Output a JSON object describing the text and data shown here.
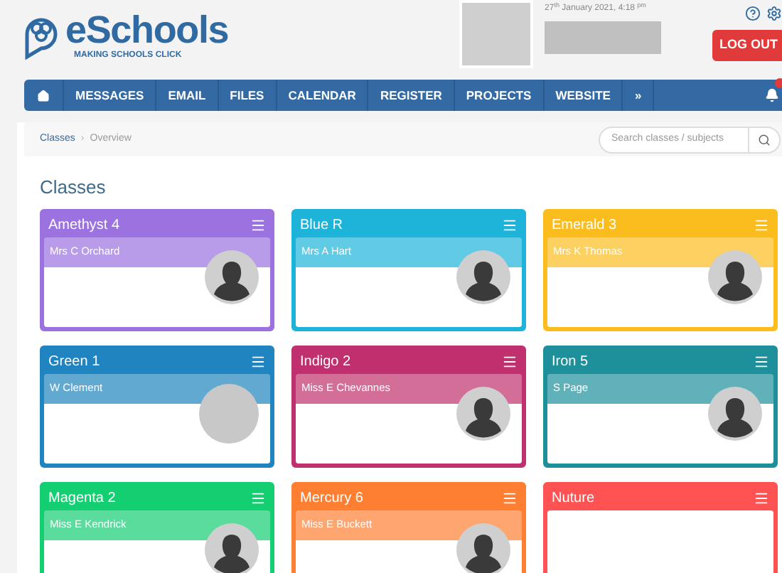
{
  "header": {
    "logo": {
      "name": "eSchools",
      "tagline": "MAKING SCHOOLS CLICK"
    },
    "date": "27$^{th}$ January 2021, 4:18 $^{pm}$",
    "logout": "LOG OUT"
  },
  "nav": {
    "items": [
      {
        "kind": "icon"
      },
      {
        "kind": "text",
        "label": "MESSAGES"
      },
      {
        "kind": "text",
        "label": "EMAIL"
      },
      {
        "kind": "text",
        "label": "FILES"
      },
      {
        "kind": "text",
        "label": "CALENDAR"
      },
      {
        "kind": "text",
        "label": "REGISTER"
      },
      {
        "kind": "text",
        "label": "PROJECTS"
      },
      {
        "kind": "text",
        "label": "WEBSITE"
      },
      {
        "kind": "text",
        "label": "»"
      }
    ]
  },
  "breadcrumb": [
    "Classes",
    "Overview"
  ],
  "breadcrumb_separator": "›",
  "search": {
    "placeholder": "Search classes / subjects"
  },
  "heading": "Classes",
  "classes": [
    {
      "name": "Amethyst 4",
      "teacher": "Mrs C Orchard",
      "color": "#9b72e0",
      "kind": "silhouette"
    },
    {
      "name": "Blue R",
      "teacher": "Mrs A Hart",
      "color": "#1eb4da",
      "kind": "silhouette"
    },
    {
      "name": "Emerald 3",
      "teacher": "Mrs K Thomas",
      "color": "#fbbc1e",
      "kind": "silhouette"
    },
    {
      "name": "Green 1",
      "teacher": "W Clement",
      "color": "#1f84bf",
      "kind": "blank"
    },
    {
      "name": "Indigo 2",
      "teacher": "Miss E Chevannes",
      "color": "#c0306e",
      "kind": "silhouette"
    },
    {
      "name": "Iron 5",
      "teacher": "S Page",
      "color": "#1e909c",
      "kind": "silhouette"
    },
    {
      "name": "Magenta 2",
      "teacher": "Miss E Kendrick",
      "color": "#14cf72",
      "kind": "silhouette"
    },
    {
      "name": "Mercury 6",
      "teacher": "Miss E Buckett",
      "color": "#ff7f32",
      "kind": "silhouette"
    },
    {
      "name": "Nuture",
      "color": "#ff5252",
      "kind": "empty"
    }
  ]
}
